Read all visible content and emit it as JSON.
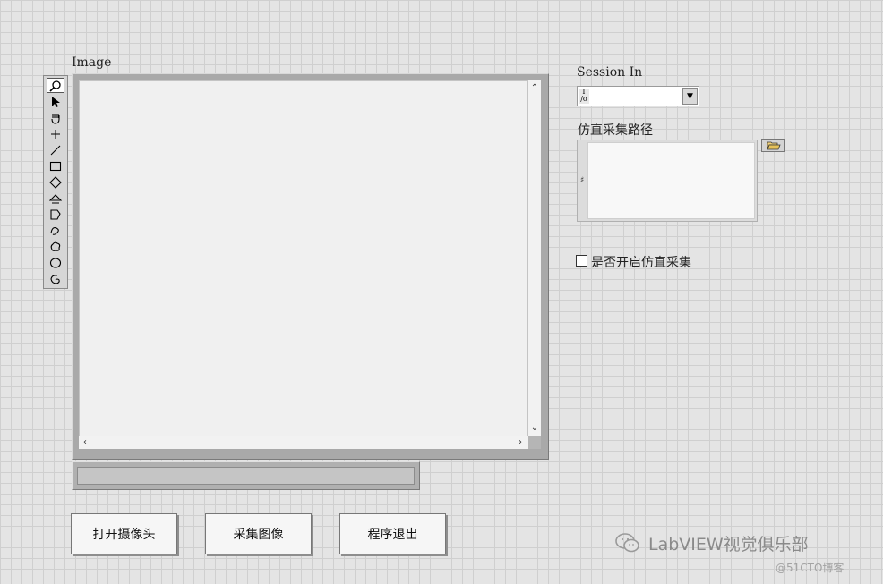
{
  "image_display": {
    "label": "Image",
    "tools": [
      "zoom-icon",
      "pointer-icon",
      "pan-hand-icon",
      "point-icon",
      "line-icon",
      "rectangle-icon",
      "rotated-rectangle-icon",
      "annulus-icon",
      "polygon-icon",
      "freehand-icon",
      "freehand-region-icon",
      "oval-icon",
      "annulus-arc-icon"
    ],
    "active_tool": "zoom-icon"
  },
  "session_in": {
    "label": "Session In",
    "io_glyph": "I/O",
    "value": ""
  },
  "sim_path": {
    "label": "仿直采集路径",
    "value": ""
  },
  "sim_toggle": {
    "label": "是否开启仿直采集",
    "checked": false
  },
  "buttons": {
    "open_camera": "打开摄像头",
    "capture_image": "采集图像",
    "exit_program": "程序退出"
  },
  "watermark": {
    "text": "LabVIEW视觉俱乐部",
    "sub": "@51CTO博客"
  }
}
